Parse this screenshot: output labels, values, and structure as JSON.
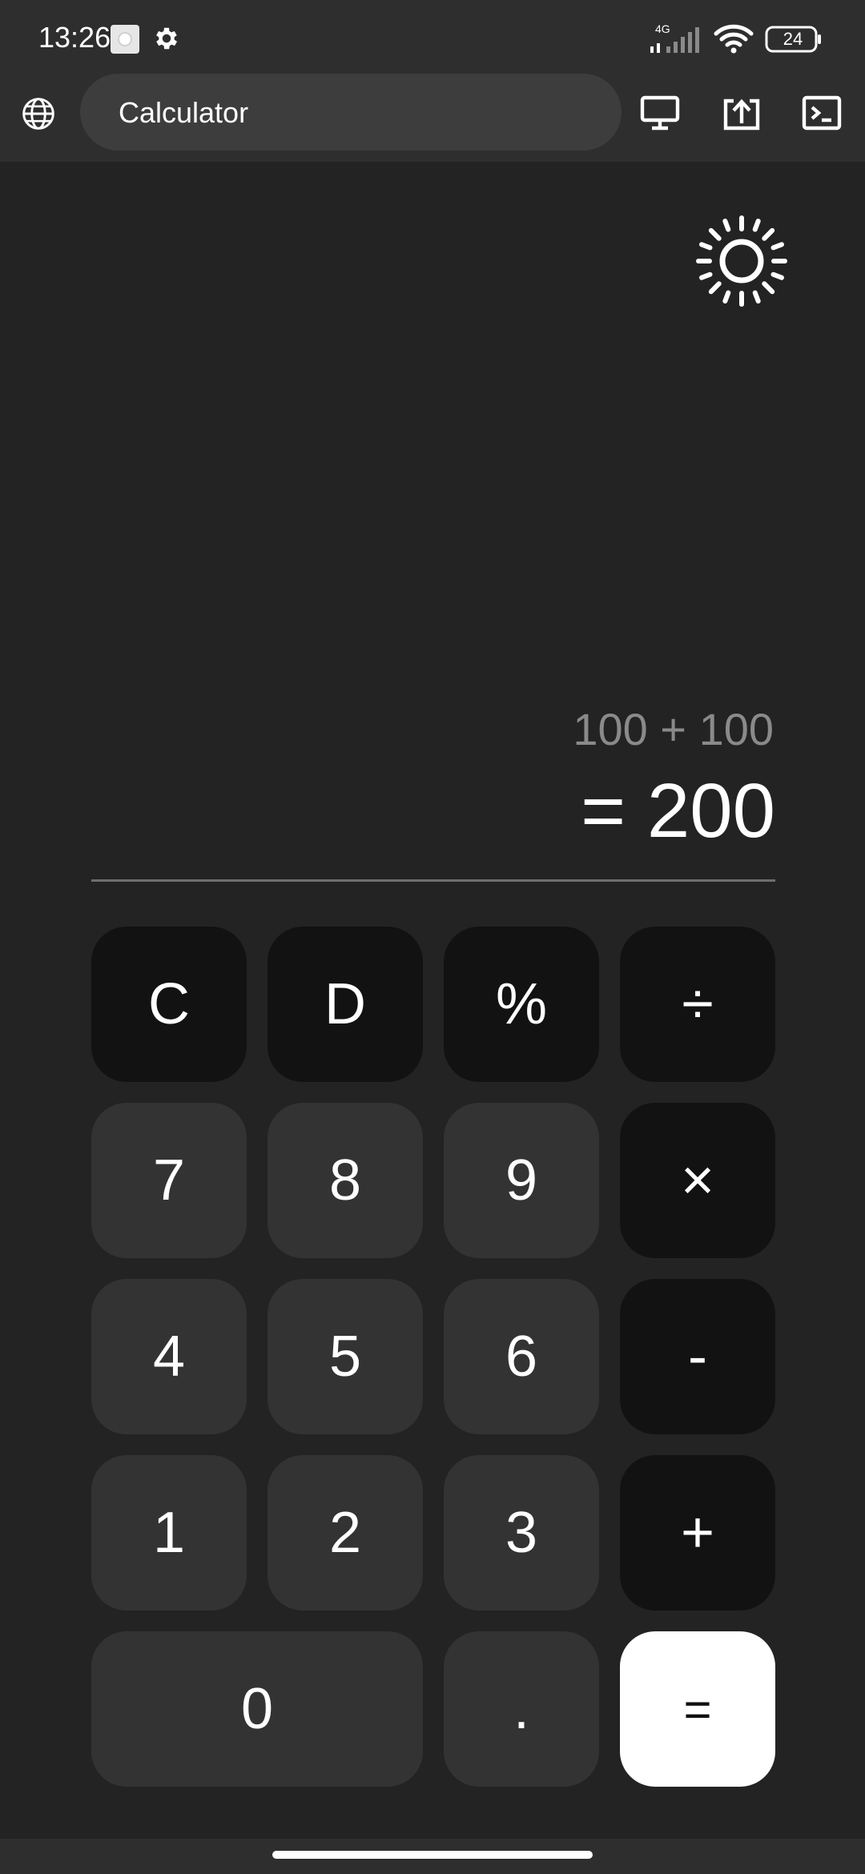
{
  "status_bar": {
    "time": "13:26",
    "network": "4G",
    "battery": "24"
  },
  "app_bar": {
    "title": "Calculator"
  },
  "display": {
    "expression": "100 + 100",
    "result": "= 200"
  },
  "keys": {
    "clear": "C",
    "delete": "D",
    "percent": "%",
    "divide": "÷",
    "seven": "7",
    "eight": "8",
    "nine": "9",
    "multiply": "×",
    "four": "4",
    "five": "5",
    "six": "6",
    "minus": "-",
    "one": "1",
    "two": "2",
    "three": "3",
    "plus": "+",
    "zero": "0",
    "decimal": ".",
    "equals": "="
  },
  "colors": {
    "background": "#232323",
    "bar": "#2e2e2e",
    "operator_key": "#121212",
    "digit_key": "#333333",
    "equals_key": "#ffffff",
    "expression_text": "#8a8a8a"
  },
  "icons": {
    "notification": "notification-icon",
    "settings": "gear-icon",
    "signal": "signal-icon",
    "wifi": "wifi-icon",
    "battery": "battery-icon",
    "globe": "globe-icon",
    "desktop": "desktop-icon",
    "share": "share-icon",
    "terminal": "terminal-icon",
    "theme": "sun-icon"
  }
}
